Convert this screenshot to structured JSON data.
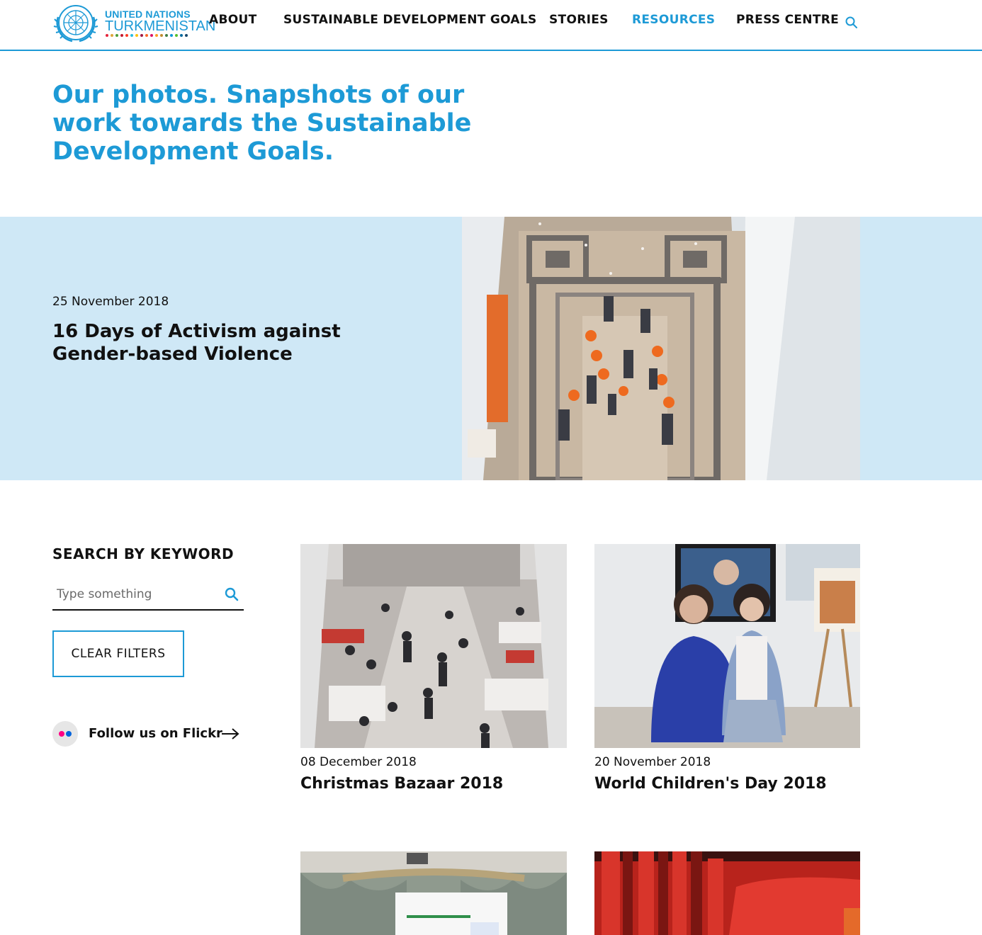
{
  "header": {
    "logo": {
      "line1": "UNITED NATIONS",
      "line2": "TURKMENISTAN",
      "dot_colors": [
        "#e5243b",
        "#dda63a",
        "#4c9f38",
        "#c5192d",
        "#ff3a21",
        "#26bde2",
        "#fcc30b",
        "#a21942",
        "#fd6925",
        "#dd1367",
        "#fd9d24",
        "#bf8b2e",
        "#3f7e44",
        "#0a97d9",
        "#56c02b",
        "#00689d",
        "#19486a"
      ]
    },
    "nav": {
      "about": "ABOUT",
      "sdgs": "SUSTAINABLE DEVELOPMENT GOALS",
      "stories": "STORIES",
      "resources": "RESOURCES",
      "press": "PRESS CENTRE"
    },
    "search_icon": "search-icon"
  },
  "page_title": "Our photos. Snapshots of our work towards the Sustainable Development Goals.",
  "feature": {
    "date": "25 November 2018",
    "title": "16 Days of Activism against Gender-based Violence"
  },
  "sidebar": {
    "search_heading": "SEARCH BY KEYWORD",
    "search_placeholder": "Type something",
    "search_value": "",
    "clear_filters": "CLEAR FILTERS",
    "flickr_label": "Follow us on Flickr",
    "flickr_icon": "flickr-icon",
    "arrow_icon": "arrow-right-icon"
  },
  "cards": [
    {
      "date": "08 December 2018",
      "title": "Christmas Bazaar 2018"
    },
    {
      "date": "20 November 2018",
      "title": "World Children's Day 2018"
    },
    {
      "date": "",
      "title": ""
    },
    {
      "date": "",
      "title": ""
    }
  ],
  "colors": {
    "accent": "#1d9ad6",
    "feature_bg": "#cfe8f6",
    "text": "#111111",
    "flickr_pink": "#ff0084",
    "flickr_blue": "#0063dc"
  }
}
